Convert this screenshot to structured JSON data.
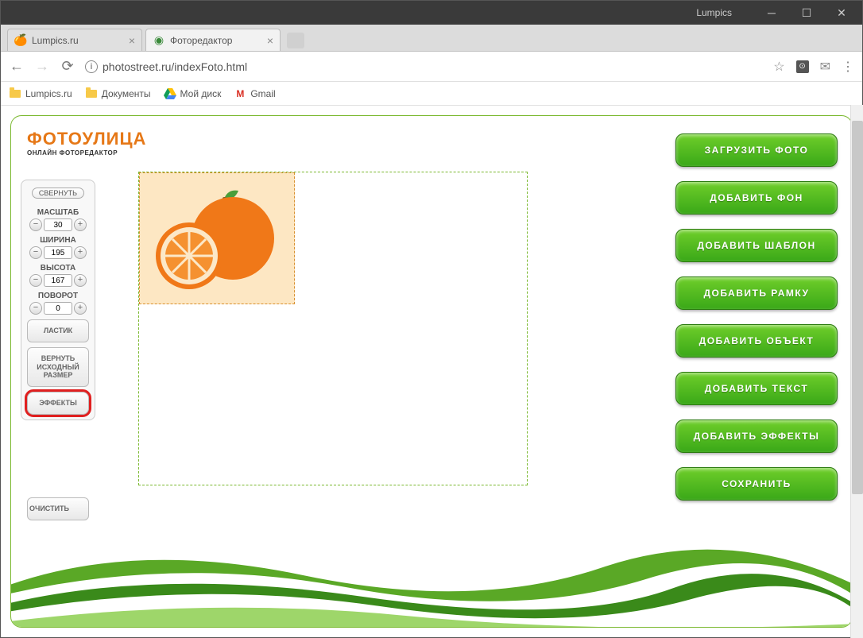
{
  "window": {
    "app_name": "Lumpics"
  },
  "tabs": [
    {
      "title": "Lumpics.ru",
      "favicon": "🍊"
    },
    {
      "title": "Фоторедактор",
      "favicon": "◎"
    }
  ],
  "address_bar": {
    "url": "photostreet.ru/indexFoto.html"
  },
  "bookmarks": [
    {
      "label": "Lumpics.ru"
    },
    {
      "label": "Документы"
    },
    {
      "label": "Мой диск"
    },
    {
      "label": "Gmail"
    }
  ],
  "logo": {
    "title": "ФОТОУЛИЦА",
    "subtitle": "ОНЛАЙН ФОТОРЕДАКТОР"
  },
  "left_panel": {
    "collapse": "СВЕРНУТЬ",
    "controls": [
      {
        "label": "МАСШТАБ",
        "value": "30"
      },
      {
        "label": "ШИРИНА",
        "value": "195"
      },
      {
        "label": "ВЫСОТА",
        "value": "167"
      },
      {
        "label": "ПОВОРОТ",
        "value": "0"
      }
    ],
    "tools": {
      "eraser": "ЛАСТИК",
      "restore": "ВЕРНУТЬ ИСХОДНЫЙ РАЗМЕР",
      "effects": "ЭФФЕКТЫ",
      "clear": "ОЧИСТИТЬ"
    }
  },
  "right_panel": {
    "buttons": [
      "ЗАГРУЗИТЬ ФОТО",
      "ДОБАВИТЬ ФОН",
      "ДОБАВИТЬ ШАБЛОН",
      "ДОБАВИТЬ РАМКУ",
      "ДОБАВИТЬ ОБЪЕКТ",
      "ДОБАВИТЬ ТЕКСТ",
      "ДОБАВИТЬ ЭФФЕКТЫ",
      "СОХРАНИТЬ"
    ]
  },
  "canvas": {
    "selected_object": "orange-image"
  }
}
